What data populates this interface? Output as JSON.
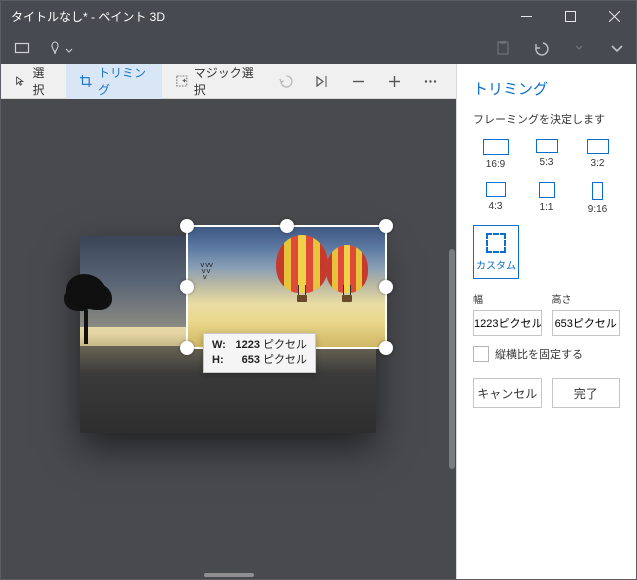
{
  "titlebar": {
    "title": "タイトルなし* - ペイント 3D"
  },
  "toolbar": {
    "select": "選択",
    "trim": "トリミング",
    "magic": "マジック選択"
  },
  "tooltip": {
    "w_label": "W:",
    "w_value": "1223",
    "w_unit": "ピクセル",
    "h_label": "H:",
    "h_value": "653",
    "h_unit": "ピクセル"
  },
  "panel": {
    "title": "トリミング",
    "subtitle": "フレーミングを決定します",
    "ratios": {
      "r169": "16:9",
      "r53": "5:3",
      "r32": "3:2",
      "r43": "4:3",
      "r11": "1:1",
      "r916": "9:16"
    },
    "custom": "カスタム",
    "width_label": "幅",
    "height_label": "高さ",
    "width_value": "1223ピクセル",
    "height_value": "653ピクセル",
    "lock_aspect": "縦横比を固定する",
    "cancel": "キャンセル",
    "done": "完了"
  }
}
